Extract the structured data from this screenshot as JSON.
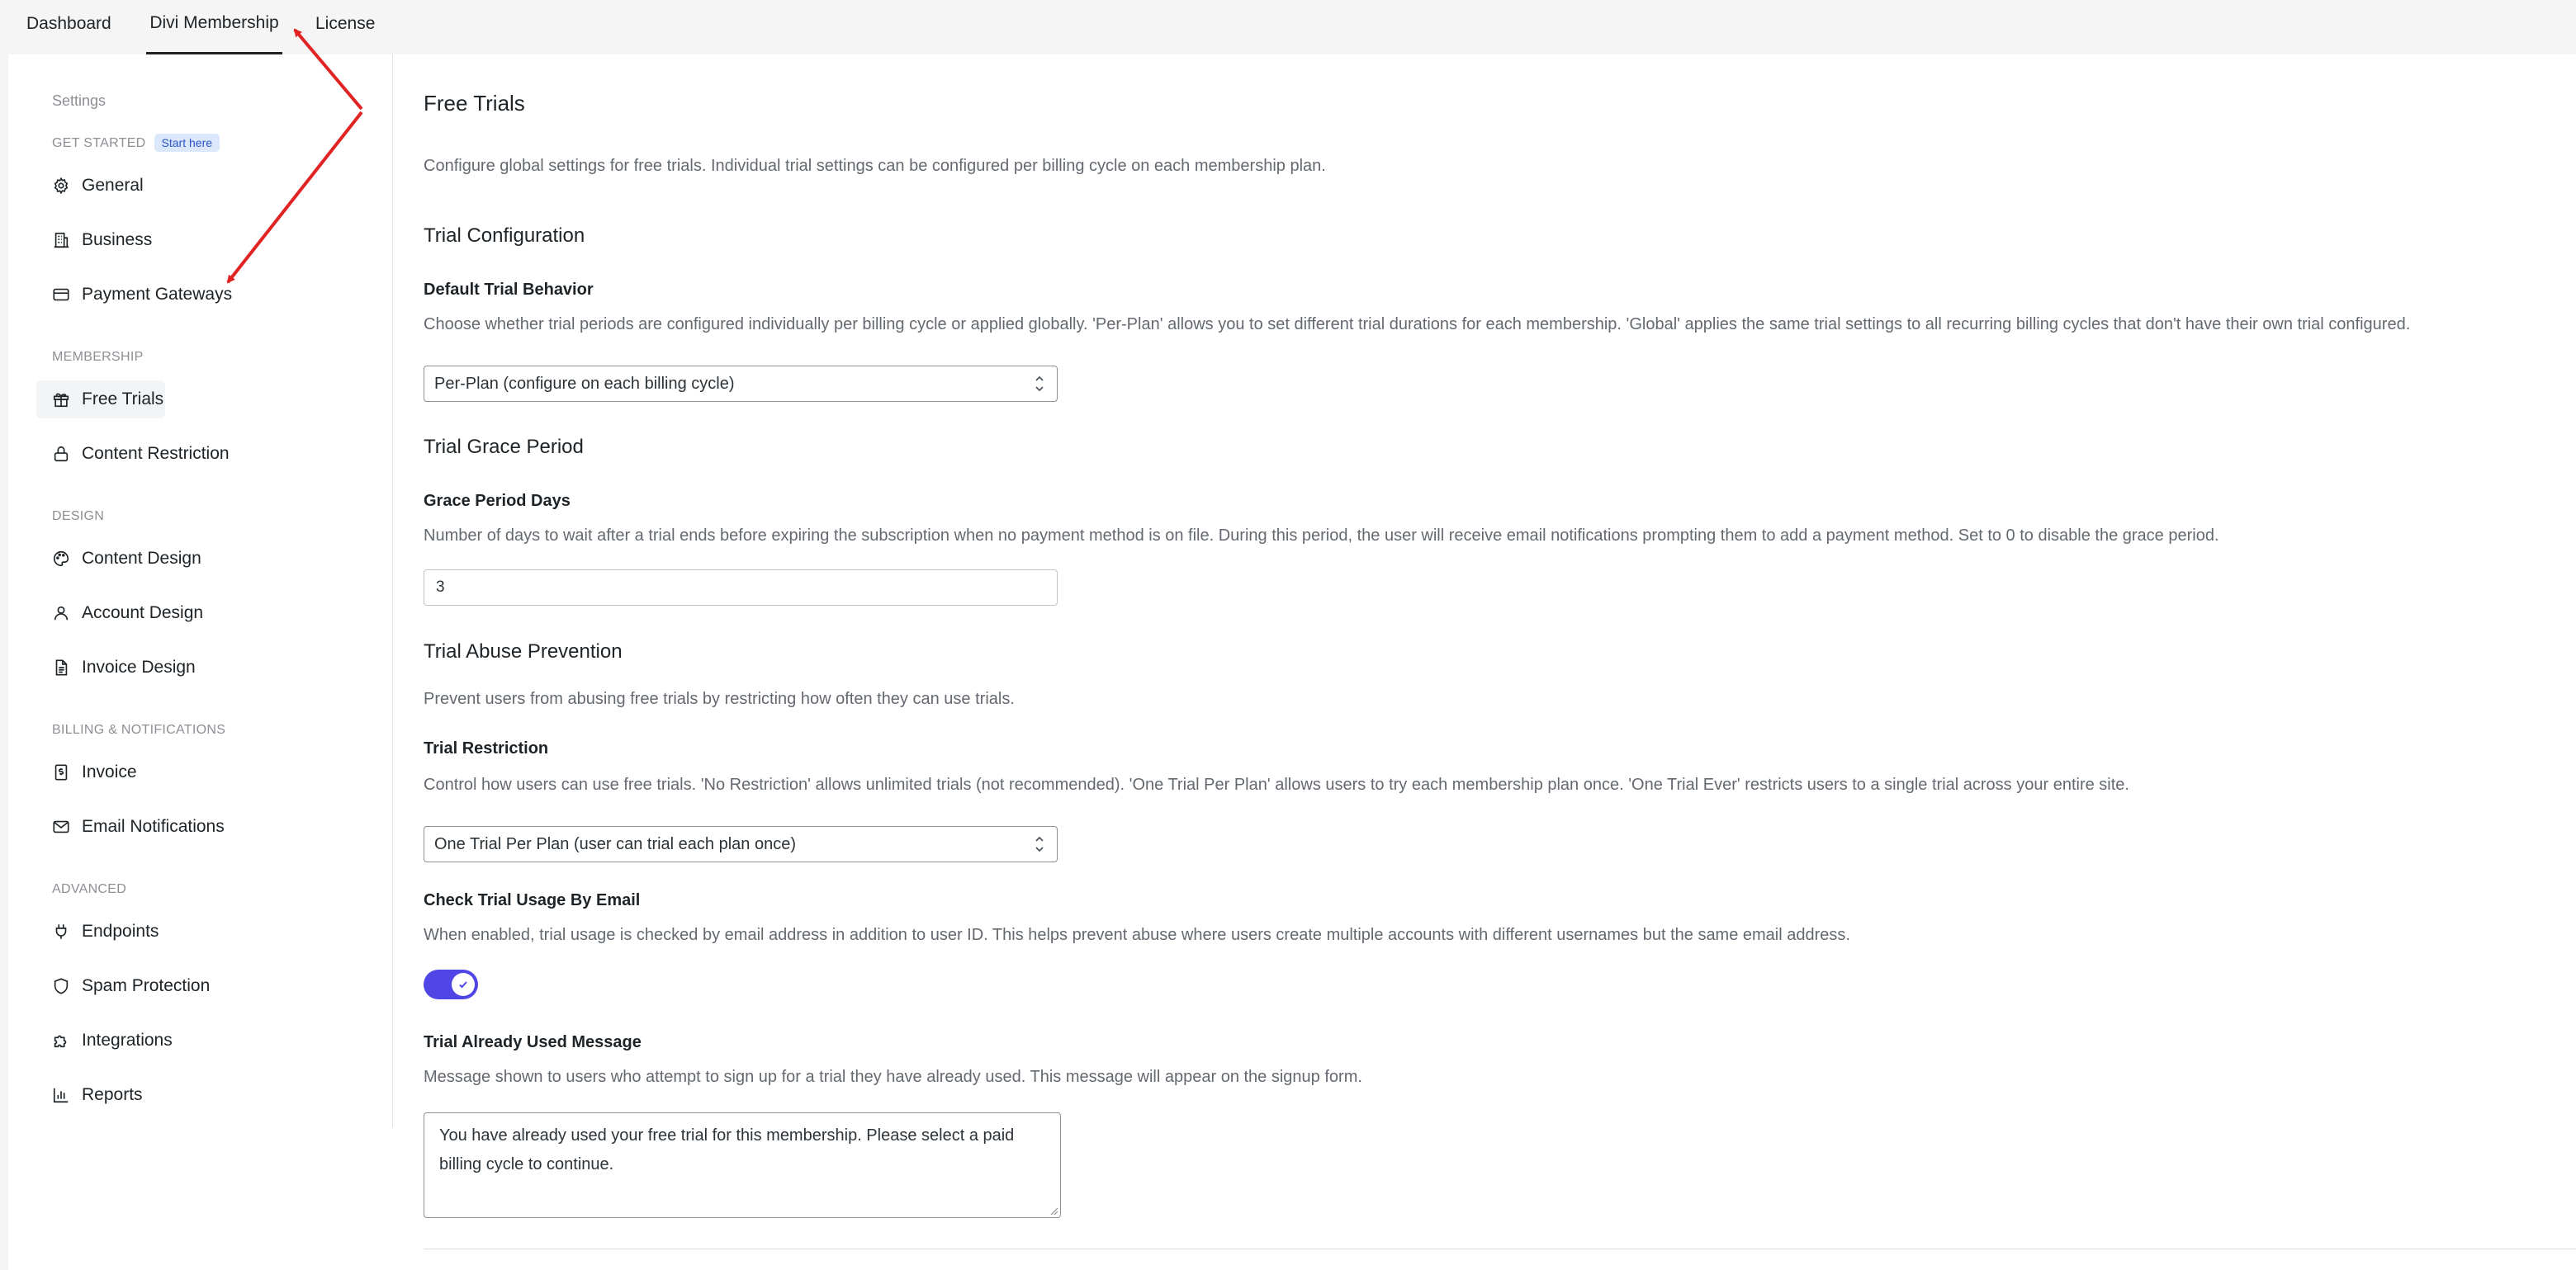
{
  "tabs": [
    {
      "label": "Dashboard"
    },
    {
      "label": "Divi Membership",
      "active": true
    },
    {
      "label": "License"
    }
  ],
  "sidebar": {
    "settings_label": "Settings",
    "groups": [
      {
        "heading": "GET STARTED",
        "badge": "Start here",
        "items": [
          {
            "label": "General",
            "icon": "gear-icon"
          },
          {
            "label": "Business",
            "icon": "building-icon"
          },
          {
            "label": "Payment Gateways",
            "icon": "credit-card-icon"
          }
        ]
      },
      {
        "heading": "MEMBERSHIP",
        "items": [
          {
            "label": "Free Trials",
            "icon": "gift-icon",
            "active": true
          },
          {
            "label": "Content Restriction",
            "icon": "lock-icon"
          }
        ]
      },
      {
        "heading": "DESIGN",
        "items": [
          {
            "label": "Content Design",
            "icon": "palette-icon"
          },
          {
            "label": "Account Design",
            "icon": "user-icon"
          },
          {
            "label": "Invoice Design",
            "icon": "document-icon"
          }
        ]
      },
      {
        "heading": "BILLING & NOTIFICATIONS",
        "items": [
          {
            "label": "Invoice",
            "icon": "receipt-dollar-icon"
          },
          {
            "label": "Email Notifications",
            "icon": "mail-icon"
          }
        ]
      },
      {
        "heading": "ADVANCED",
        "items": [
          {
            "label": "Endpoints",
            "icon": "plug-icon"
          },
          {
            "label": "Spam Protection",
            "icon": "shield-icon"
          },
          {
            "label": "Integrations",
            "icon": "puzzle-icon"
          },
          {
            "label": "Reports",
            "icon": "bar-chart-icon"
          }
        ]
      }
    ]
  },
  "main": {
    "title": "Free Trials",
    "intro": "Configure global settings for free trials. Individual trial settings can be configured per billing cycle on each membership plan.",
    "trial_configuration": {
      "section_title": "Trial Configuration",
      "default_behavior": {
        "label": "Default Trial Behavior",
        "description": "Choose whether trial periods are configured individually per billing cycle or applied globally. 'Per-Plan' allows you to set different trial durations for each membership. 'Global' applies the same trial settings to all recurring billing cycles that don't have their own trial configured.",
        "value": "Per-Plan (configure on each billing cycle)"
      }
    },
    "grace_period": {
      "section_title": "Trial Grace Period",
      "days": {
        "label": "Grace Period Days",
        "description": "Number of days to wait after a trial ends before expiring the subscription when no payment method is on file. During this period, the user will receive email notifications prompting them to add a payment method. Set to 0 to disable the grace period.",
        "value": "3"
      }
    },
    "abuse_prevention": {
      "section_title": "Trial Abuse Prevention",
      "description": "Prevent users from abusing free trials by restricting how often they can use trials.",
      "restriction": {
        "label": "Trial Restriction",
        "description": "Control how users can use free trials. 'No Restriction' allows unlimited trials (not recommended). 'One Trial Per Plan' allows users to try each membership plan once. 'One Trial Ever' restricts users to a single trial across your entire site.",
        "value": "One Trial Per Plan (user can trial each plan once)"
      },
      "check_email": {
        "label": "Check Trial Usage By Email",
        "description": "When enabled, trial usage is checked by email address in addition to user ID. This helps prevent abuse where users create multiple accounts with different usernames but the same email address.",
        "enabled": true
      },
      "used_message": {
        "label": "Trial Already Used Message",
        "description": "Message shown to users who attempt to sign up for a trial they have already used. This message will appear on the signup form.",
        "value": "You have already used your free trial for this membership. Please select a paid billing cycle to continue."
      }
    }
  },
  "colors": {
    "accent": "#4f46e5",
    "annotation_arrow": "#e02424",
    "badge_bg": "#dbe7fb",
    "badge_text": "#2a56c6"
  }
}
